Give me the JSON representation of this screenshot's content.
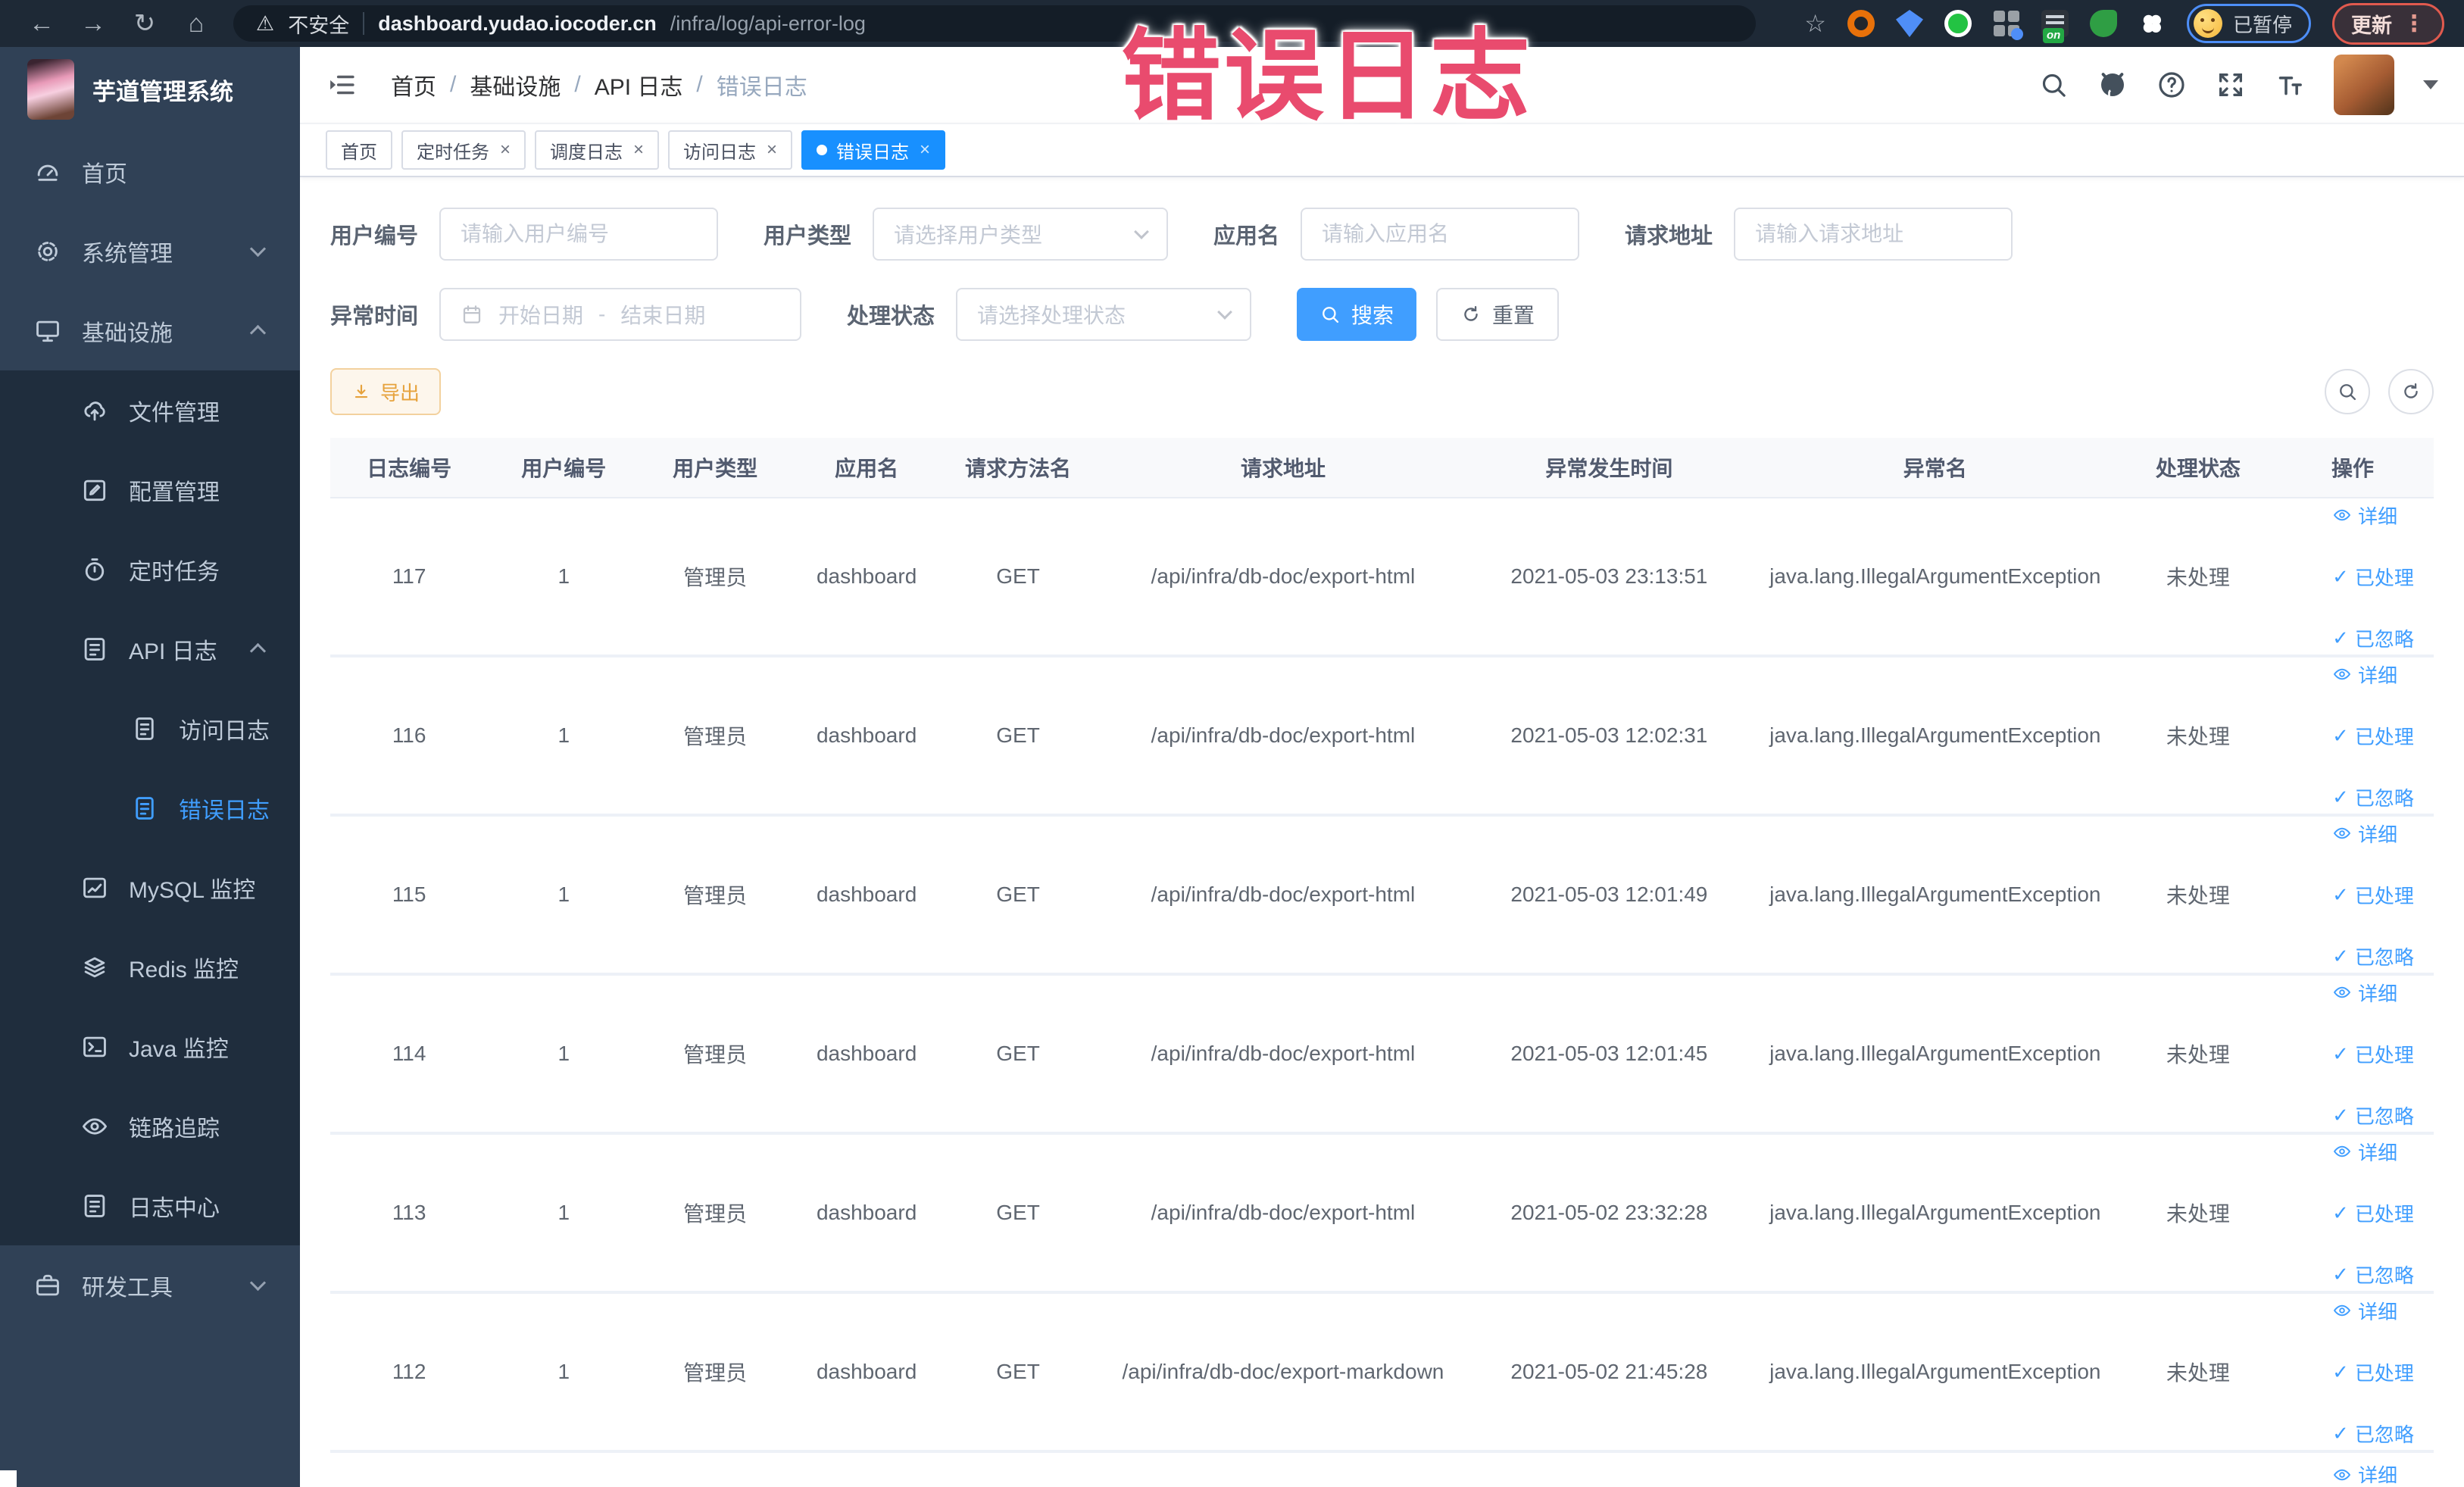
{
  "colors": {
    "accent": "#409eff",
    "tab_active_bg": "#1890ff",
    "sidebar_bg": "#304156",
    "submenu_bg": "#1f2d3d",
    "sidebar_text": "#bfcbd9",
    "overlay_text": "#e94b6e",
    "warning": "#e6a23c",
    "browser_bar_bg": "#1e2936",
    "update_red": "#e05a4e",
    "paused_ring_blue": "#4d8ef7"
  },
  "icons": {
    "back": "←",
    "forward": "→",
    "reload": "↻",
    "home": "⌂",
    "warning": "⚠",
    "star": "☆",
    "close": "×",
    "check": "✓",
    "kebab": "⋮"
  },
  "browser": {
    "security_label": "不安全",
    "url_domain": "dashboard.yudao.iocoder.cn",
    "url_path": "/infra/log/api-error-log",
    "extension_badge": "on",
    "paused_label": "已暂停",
    "update_label": "更新"
  },
  "overlay_title": "错误日志",
  "sidebar": {
    "logo_title": "芋道管理系统",
    "items": [
      {
        "label": "首页",
        "icon": "dashboard",
        "level": 1
      },
      {
        "label": "系统管理",
        "icon": "gear",
        "level": 1,
        "arrow": "down"
      },
      {
        "label": "基础设施",
        "icon": "monitor",
        "level": 1,
        "arrow": "up"
      },
      {
        "label": "文件管理",
        "icon": "upload",
        "level": 2
      },
      {
        "label": "配置管理",
        "icon": "edit",
        "level": 2
      },
      {
        "label": "定时任务",
        "icon": "timer",
        "level": 2
      },
      {
        "label": "API 日志",
        "icon": "log",
        "level": 2,
        "arrow": "up"
      },
      {
        "label": "访问日志",
        "icon": "doc",
        "level": 3
      },
      {
        "label": "错误日志",
        "icon": "doc",
        "level": 3,
        "active": true
      },
      {
        "label": "MySQL 监控",
        "icon": "chart",
        "level": 2
      },
      {
        "label": "Redis 监控",
        "icon": "layers",
        "level": 2
      },
      {
        "label": "Java 监控",
        "icon": "terminal",
        "level": 2
      },
      {
        "label": "链路追踪",
        "icon": "eye",
        "level": 2
      },
      {
        "label": "日志中心",
        "icon": "log",
        "level": 2
      },
      {
        "label": "研发工具",
        "icon": "briefcase",
        "level": 1,
        "arrow": "down"
      }
    ]
  },
  "header": {
    "breadcrumb": [
      "首页",
      "基础设施",
      "API 日志",
      "错误日志"
    ],
    "separator": "/"
  },
  "tabs": [
    {
      "label": "首页",
      "closable": false,
      "active": false
    },
    {
      "label": "定时任务",
      "closable": true,
      "active": false
    },
    {
      "label": "调度日志",
      "closable": true,
      "active": false
    },
    {
      "label": "访问日志",
      "closable": true,
      "active": false
    },
    {
      "label": "错误日志",
      "closable": true,
      "active": true
    }
  ],
  "filters": {
    "user_id": {
      "label": "用户编号",
      "placeholder": "请输入用户编号"
    },
    "user_type": {
      "label": "用户类型",
      "placeholder": "请选择用户类型"
    },
    "app_name": {
      "label": "应用名",
      "placeholder": "请输入应用名"
    },
    "request_url": {
      "label": "请求地址",
      "placeholder": "请输入请求地址"
    },
    "exception_time": {
      "label": "异常时间",
      "start_placeholder": "开始日期",
      "separator": "-",
      "end_placeholder": "结束日期"
    },
    "process_status": {
      "label": "处理状态",
      "placeholder": "请选择处理状态"
    },
    "search_label": "搜索",
    "reset_label": "重置"
  },
  "toolbar": {
    "export_label": "导出"
  },
  "table": {
    "headers": [
      "日志编号",
      "用户编号",
      "用户类型",
      "应用名",
      "请求方法名",
      "请求地址",
      "异常发生时间",
      "异常名",
      "处理状态",
      "操作"
    ],
    "actions": [
      "详细",
      "已处理",
      "已忽略"
    ],
    "rows": [
      {
        "id": "117",
        "user_id": "1",
        "user_type": "管理员",
        "app": "dashboard",
        "method": "GET",
        "url": "/api/infra/db-doc/export-html",
        "time": "2021-05-03 23:13:51",
        "exception": "java.lang.IllegalArgumentException",
        "status": "未处理"
      },
      {
        "id": "116",
        "user_id": "1",
        "user_type": "管理员",
        "app": "dashboard",
        "method": "GET",
        "url": "/api/infra/db-doc/export-html",
        "time": "2021-05-03 12:02:31",
        "exception": "java.lang.IllegalArgumentException",
        "status": "未处理"
      },
      {
        "id": "115",
        "user_id": "1",
        "user_type": "管理员",
        "app": "dashboard",
        "method": "GET",
        "url": "/api/infra/db-doc/export-html",
        "time": "2021-05-03 12:01:49",
        "exception": "java.lang.IllegalArgumentException",
        "status": "未处理"
      },
      {
        "id": "114",
        "user_id": "1",
        "user_type": "管理员",
        "app": "dashboard",
        "method": "GET",
        "url": "/api/infra/db-doc/export-html",
        "time": "2021-05-03 12:01:45",
        "exception": "java.lang.IllegalArgumentException",
        "status": "未处理"
      },
      {
        "id": "113",
        "user_id": "1",
        "user_type": "管理员",
        "app": "dashboard",
        "method": "GET",
        "url": "/api/infra/db-doc/export-html",
        "time": "2021-05-02 23:32:28",
        "exception": "java.lang.IllegalArgumentException",
        "status": "未处理"
      },
      {
        "id": "112",
        "user_id": "1",
        "user_type": "管理员",
        "app": "dashboard",
        "method": "GET",
        "url": "/api/infra/db-doc/export-markdown",
        "time": "2021-05-02 21:45:28",
        "exception": "java.lang.IllegalArgumentException",
        "status": "未处理"
      }
    ]
  }
}
